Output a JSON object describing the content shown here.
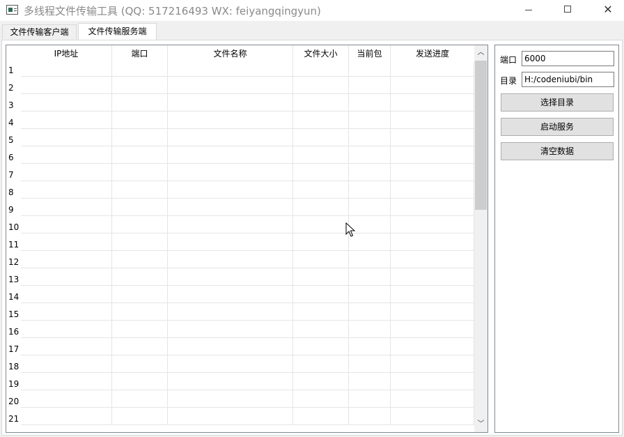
{
  "window": {
    "title": "多线程文件传输工具 (QQ: 517216493 WX: feiyangqingyun)",
    "minimize_glyph": "—",
    "close_glyph": "✕"
  },
  "tabs": [
    {
      "label": "文件传输客户端",
      "active": false
    },
    {
      "label": "文件传输服务端",
      "active": true
    }
  ],
  "table": {
    "columns": [
      "IP地址",
      "端口",
      "文件名称",
      "文件大小",
      "当前包",
      "发送进度"
    ],
    "row_numbers": [
      "1",
      "2",
      "3",
      "4",
      "5",
      "6",
      "7",
      "8",
      "9",
      "10",
      "11",
      "12",
      "13",
      "14",
      "15",
      "16",
      "17",
      "18",
      "19",
      "20",
      "21"
    ]
  },
  "scrollbar": {
    "up_glyph": "︿",
    "down_glyph": "﹀"
  },
  "panel": {
    "port_label": "端口",
    "port_value": "6000",
    "dir_label": "目录",
    "dir_value": "H:/codeniubi/bin",
    "select_dir_button": "选择目录",
    "start_service_button": "启动服务",
    "clear_data_button": "清空数据"
  },
  "icons": {
    "app": "app-window-icon",
    "cursor": "mouse-cursor-icon"
  }
}
